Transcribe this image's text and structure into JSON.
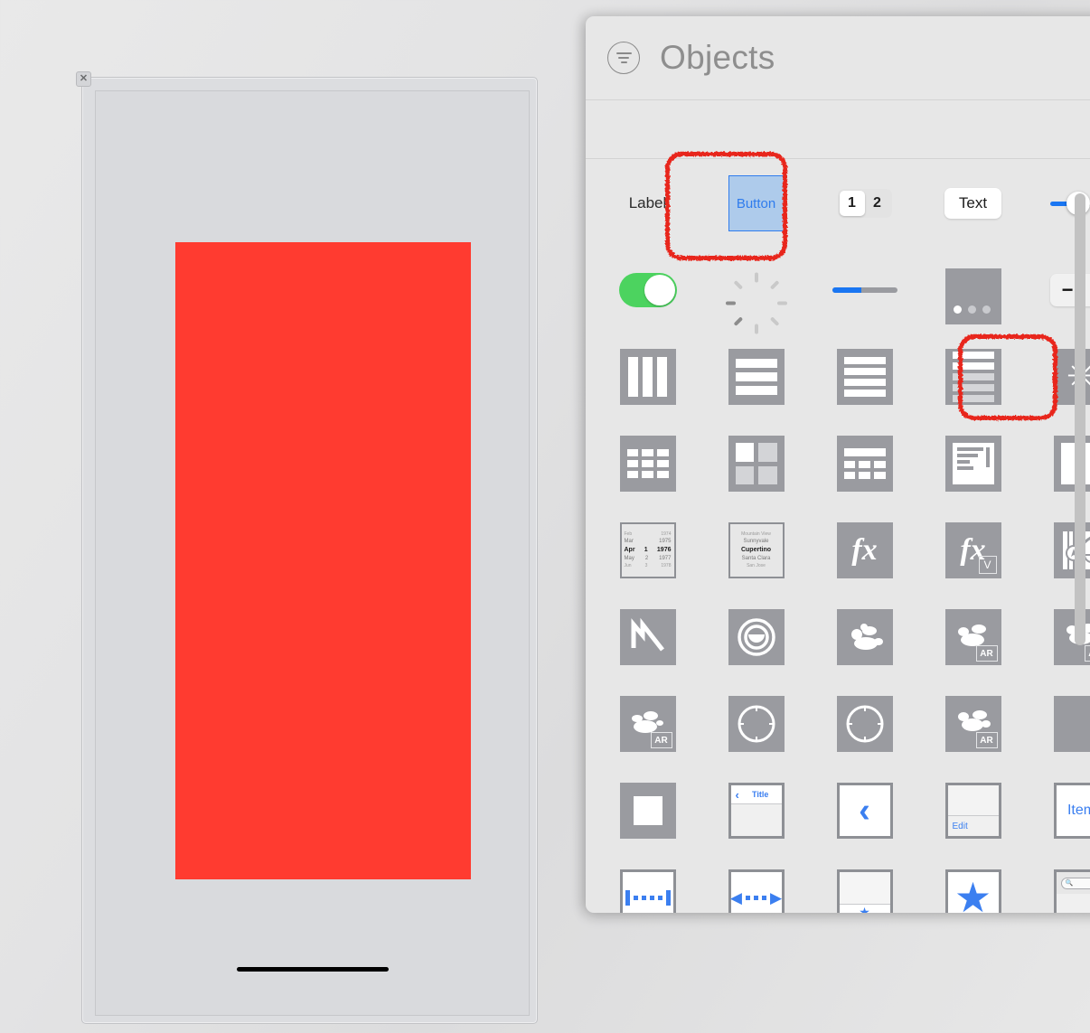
{
  "canvas": {
    "close_badge": "✕",
    "red_rect_color": "#FF3B30"
  },
  "library": {
    "title": "Objects",
    "filter_icon": "filter-icon",
    "rows": [
      {
        "name": "controls-row",
        "items": [
          {
            "kind": "label",
            "text": "Label",
            "name": "label-object"
          },
          {
            "kind": "button",
            "text": "Button",
            "name": "button-object",
            "annotated": true
          },
          {
            "kind": "segmented",
            "options": [
              "1",
              "2"
            ],
            "selected": "1",
            "name": "segmented-control-object"
          },
          {
            "kind": "textfield",
            "text": "Text",
            "name": "text-field-object"
          },
          {
            "kind": "slider",
            "name": "slider-object",
            "value_pct": 35
          }
        ]
      },
      {
        "name": "indicators-row",
        "items": [
          {
            "kind": "switch",
            "name": "switch-object",
            "on": true,
            "color": "#4CD35F"
          },
          {
            "kind": "activity",
            "name": "activity-indicator-object"
          },
          {
            "kind": "progress",
            "name": "progress-view-object",
            "value_pct": 45,
            "color": "#1A76F2"
          },
          {
            "kind": "pagecontrol",
            "name": "page-control-object",
            "pages": 3,
            "current": 1
          },
          {
            "kind": "stepper",
            "name": "stepper-object",
            "minus": "−",
            "plus": "+"
          }
        ]
      },
      {
        "name": "stacks-row",
        "items": [
          {
            "kind": "hstack",
            "name": "horizontal-stack-view-object"
          },
          {
            "kind": "vstack",
            "name": "vertical-stack-view-object"
          },
          {
            "kind": "tableview",
            "name": "table-view-object"
          },
          {
            "kind": "tablecell",
            "name": "table-view-cell-object"
          },
          {
            "kind": "imageview",
            "name": "image-view-object",
            "annotated": true
          }
        ]
      },
      {
        "name": "collections-row",
        "items": [
          {
            "kind": "collection",
            "name": "collection-view-object"
          },
          {
            "kind": "collectioncell",
            "name": "collection-view-cell-object"
          },
          {
            "kind": "collectionreuse",
            "name": "collection-reusable-view-object"
          },
          {
            "kind": "textview",
            "name": "text-view-object"
          },
          {
            "kind": "scrollview",
            "name": "scroll-view-object"
          }
        ]
      },
      {
        "name": "pickers-row",
        "items": [
          {
            "kind": "datepicker",
            "name": "date-picker-object",
            "rows": [
              {
                "cols": [
                  "Feb",
                  "",
                  "1974"
                ],
                "style": "far"
              },
              {
                "cols": [
                  "Mar",
                  "",
                  "1975"
                ],
                "style": "near"
              },
              {
                "cols": [
                  "Apr",
                  "1",
                  "1976"
                ],
                "style": "sel"
              },
              {
                "cols": [
                  "May",
                  "2",
                  "1977"
                ],
                "style": "near"
              },
              {
                "cols": [
                  "Jun",
                  "3",
                  "1978"
                ],
                "style": "far"
              }
            ]
          },
          {
            "kind": "pickerview",
            "name": "picker-view-object",
            "rows": [
              {
                "text": "Mountain View",
                "style": "far"
              },
              {
                "text": "Sunnyvale",
                "style": "near"
              },
              {
                "text": "Cupertino",
                "style": "sel"
              },
              {
                "text": "Santa Clara",
                "style": "near"
              },
              {
                "text": "San Jose",
                "style": "far"
              }
            ]
          },
          {
            "kind": "fx",
            "name": "visual-effect-view-object",
            "glyph": "fx"
          },
          {
            "kind": "fxv",
            "name": "visual-effect-view-vibrancy-object",
            "glyph": "fx",
            "badge": "V"
          },
          {
            "kind": "mapview",
            "name": "map-view-object"
          }
        ]
      },
      {
        "name": "graphics-row",
        "items": [
          {
            "kind": "metal",
            "name": "metal-view-object"
          },
          {
            "kind": "scenekit",
            "name": "scene-kit-view-object"
          },
          {
            "kind": "spritekit",
            "name": "sprite-kit-view-object"
          },
          {
            "kind": "scnar",
            "name": "scene-kit-ar-view-object",
            "badge": "AR"
          },
          {
            "kind": "spritear",
            "name": "sprite-kit-ar-view-object",
            "badge": "AR"
          }
        ]
      },
      {
        "name": "webviews-row",
        "items": [
          {
            "kind": "arview",
            "name": "ar-view-object",
            "badge": "AR"
          },
          {
            "kind": "webkit",
            "name": "wk-web-view-object"
          },
          {
            "kind": "webview",
            "name": "web-view-object"
          },
          {
            "kind": "arscn",
            "name": "ar-scn-view-object",
            "badge": "AR"
          },
          {
            "kind": "plainview",
            "name": "view-object"
          }
        ]
      },
      {
        "name": "navigation-row",
        "items": [
          {
            "kind": "container",
            "name": "container-view-object"
          },
          {
            "kind": "navbar",
            "name": "navigation-bar-object",
            "back": "‹",
            "title": "Title"
          },
          {
            "kind": "backbutton",
            "name": "navigation-item-object",
            "glyph": "‹"
          },
          {
            "kind": "toolbar",
            "name": "toolbar-object",
            "label": "Edit"
          },
          {
            "kind": "baritem",
            "name": "bar-button-item-object",
            "label": "Item"
          }
        ]
      },
      {
        "name": "bar-items-row",
        "items": [
          {
            "kind": "fixedspace",
            "name": "fixed-space-bar-button-item-object"
          },
          {
            "kind": "flexspace",
            "name": "flexible-space-bar-button-item-object"
          },
          {
            "kind": "tabbaritem",
            "name": "tab-bar-item-object"
          },
          {
            "kind": "tabbar",
            "name": "tab-bar-object"
          },
          {
            "kind": "searchbar",
            "name": "search-bar-object",
            "placeholder": ""
          }
        ]
      }
    ]
  }
}
